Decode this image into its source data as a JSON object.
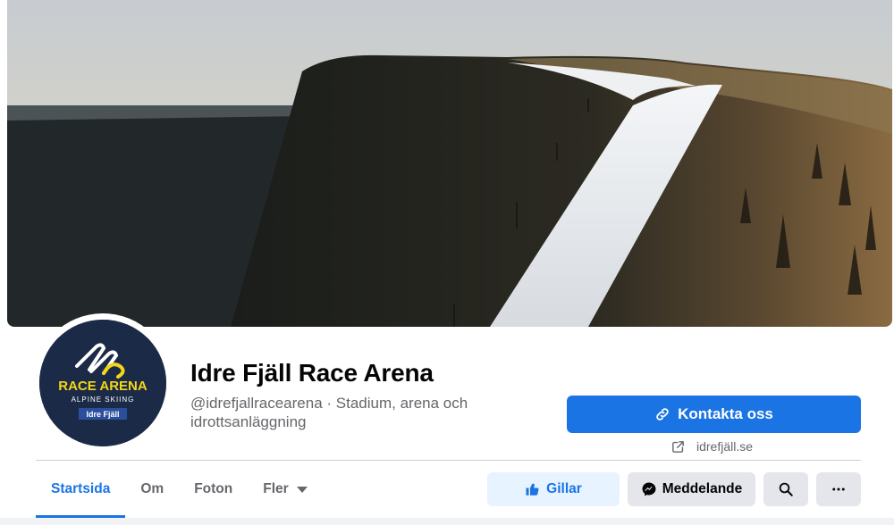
{
  "page": {
    "name": "Idre Fjäll Race Arena",
    "handle_category": "@idrefjallracearena · Stadium, arena och idrottsanläggning"
  },
  "avatar": {
    "logo_line1": "RACE ARENA",
    "logo_line2": "ALPINE SKIING",
    "logo_badge": "Idre Fjäll",
    "colors": {
      "background": "#1b2a47",
      "accent": "#f5d617",
      "badge": "#2b4f9c"
    }
  },
  "actions": {
    "contact_label": "Kontakta oss",
    "contact_icon": "link-icon",
    "website_label": "idrefjäll.se",
    "website_icon": "external-link-icon",
    "like_label": "Gillar",
    "like_icon": "thumbs-up-icon",
    "message_label": "Meddelande",
    "message_icon": "messenger-icon",
    "search_icon": "search-icon",
    "more_icon": "more-icon"
  },
  "tabs": [
    {
      "label": "Startsida",
      "active": true
    },
    {
      "label": "Om",
      "active": false
    },
    {
      "label": "Foton",
      "active": false
    },
    {
      "label": "Fler",
      "active": false,
      "has_dropdown": true
    }
  ],
  "colors": {
    "primary": "#1b74e4",
    "primary_light": "#e7f3ff",
    "secondary_button": "#e4e6eb",
    "text_secondary": "#65676b"
  }
}
